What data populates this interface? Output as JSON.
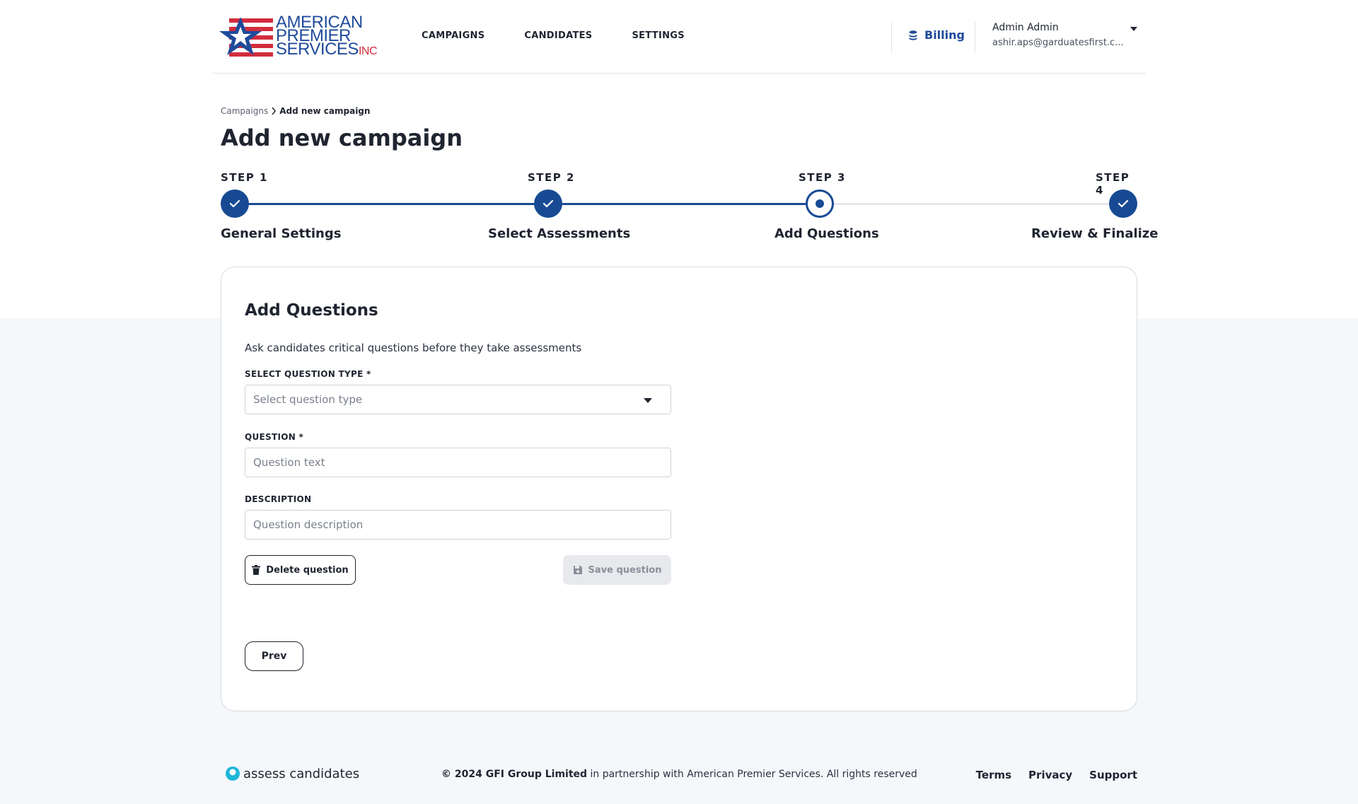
{
  "header": {
    "logo": {
      "line1": "AMERICAN",
      "line2": "PREMIER",
      "line3": "SERVICES",
      "suffix": "INC"
    },
    "nav": [
      "CAMPAIGNS",
      "CANDIDATES",
      "SETTINGS"
    ],
    "billing_label": "Billing",
    "user": {
      "name": "Admin Admin",
      "email": "ashir.aps@garduatesfirst.c..."
    }
  },
  "breadcrumb": {
    "parent": "Campaigns",
    "current": "Add new campaign"
  },
  "page_title": "Add new campaign",
  "stepper": {
    "steps": [
      {
        "label": "STEP 1",
        "name": "General Settings",
        "state": "done"
      },
      {
        "label": "STEP 2",
        "name": "Select Assessments",
        "state": "done"
      },
      {
        "label": "STEP 3",
        "name": "Add Questions",
        "state": "current"
      },
      {
        "label": "STEP 4",
        "name": "Review & Finalize",
        "state": "done"
      }
    ]
  },
  "form": {
    "title": "Add Questions",
    "subtitle": "Ask candidates critical questions before they take assessments",
    "question_type": {
      "label": "SELECT QUESTION TYPE *",
      "placeholder": "Select question type"
    },
    "question": {
      "label": "QUESTION *",
      "placeholder": "Question text"
    },
    "description": {
      "label": "DESCRIPTION",
      "placeholder": "Question description"
    },
    "delete_label": "Delete question",
    "save_label": "Save question",
    "prev_label": "Prev"
  },
  "footer": {
    "brand": "assess candidates",
    "copyright_bold": "© 2024 GFI Group Limited",
    "copyright_rest": " in partnership with American Premier Services. All rights reserved",
    "links": [
      "Terms",
      "Privacy",
      "Support"
    ]
  },
  "colors": {
    "primary": "#174a93",
    "logo_red": "#d22d3d",
    "accent_teal": "#1fb6d9"
  }
}
